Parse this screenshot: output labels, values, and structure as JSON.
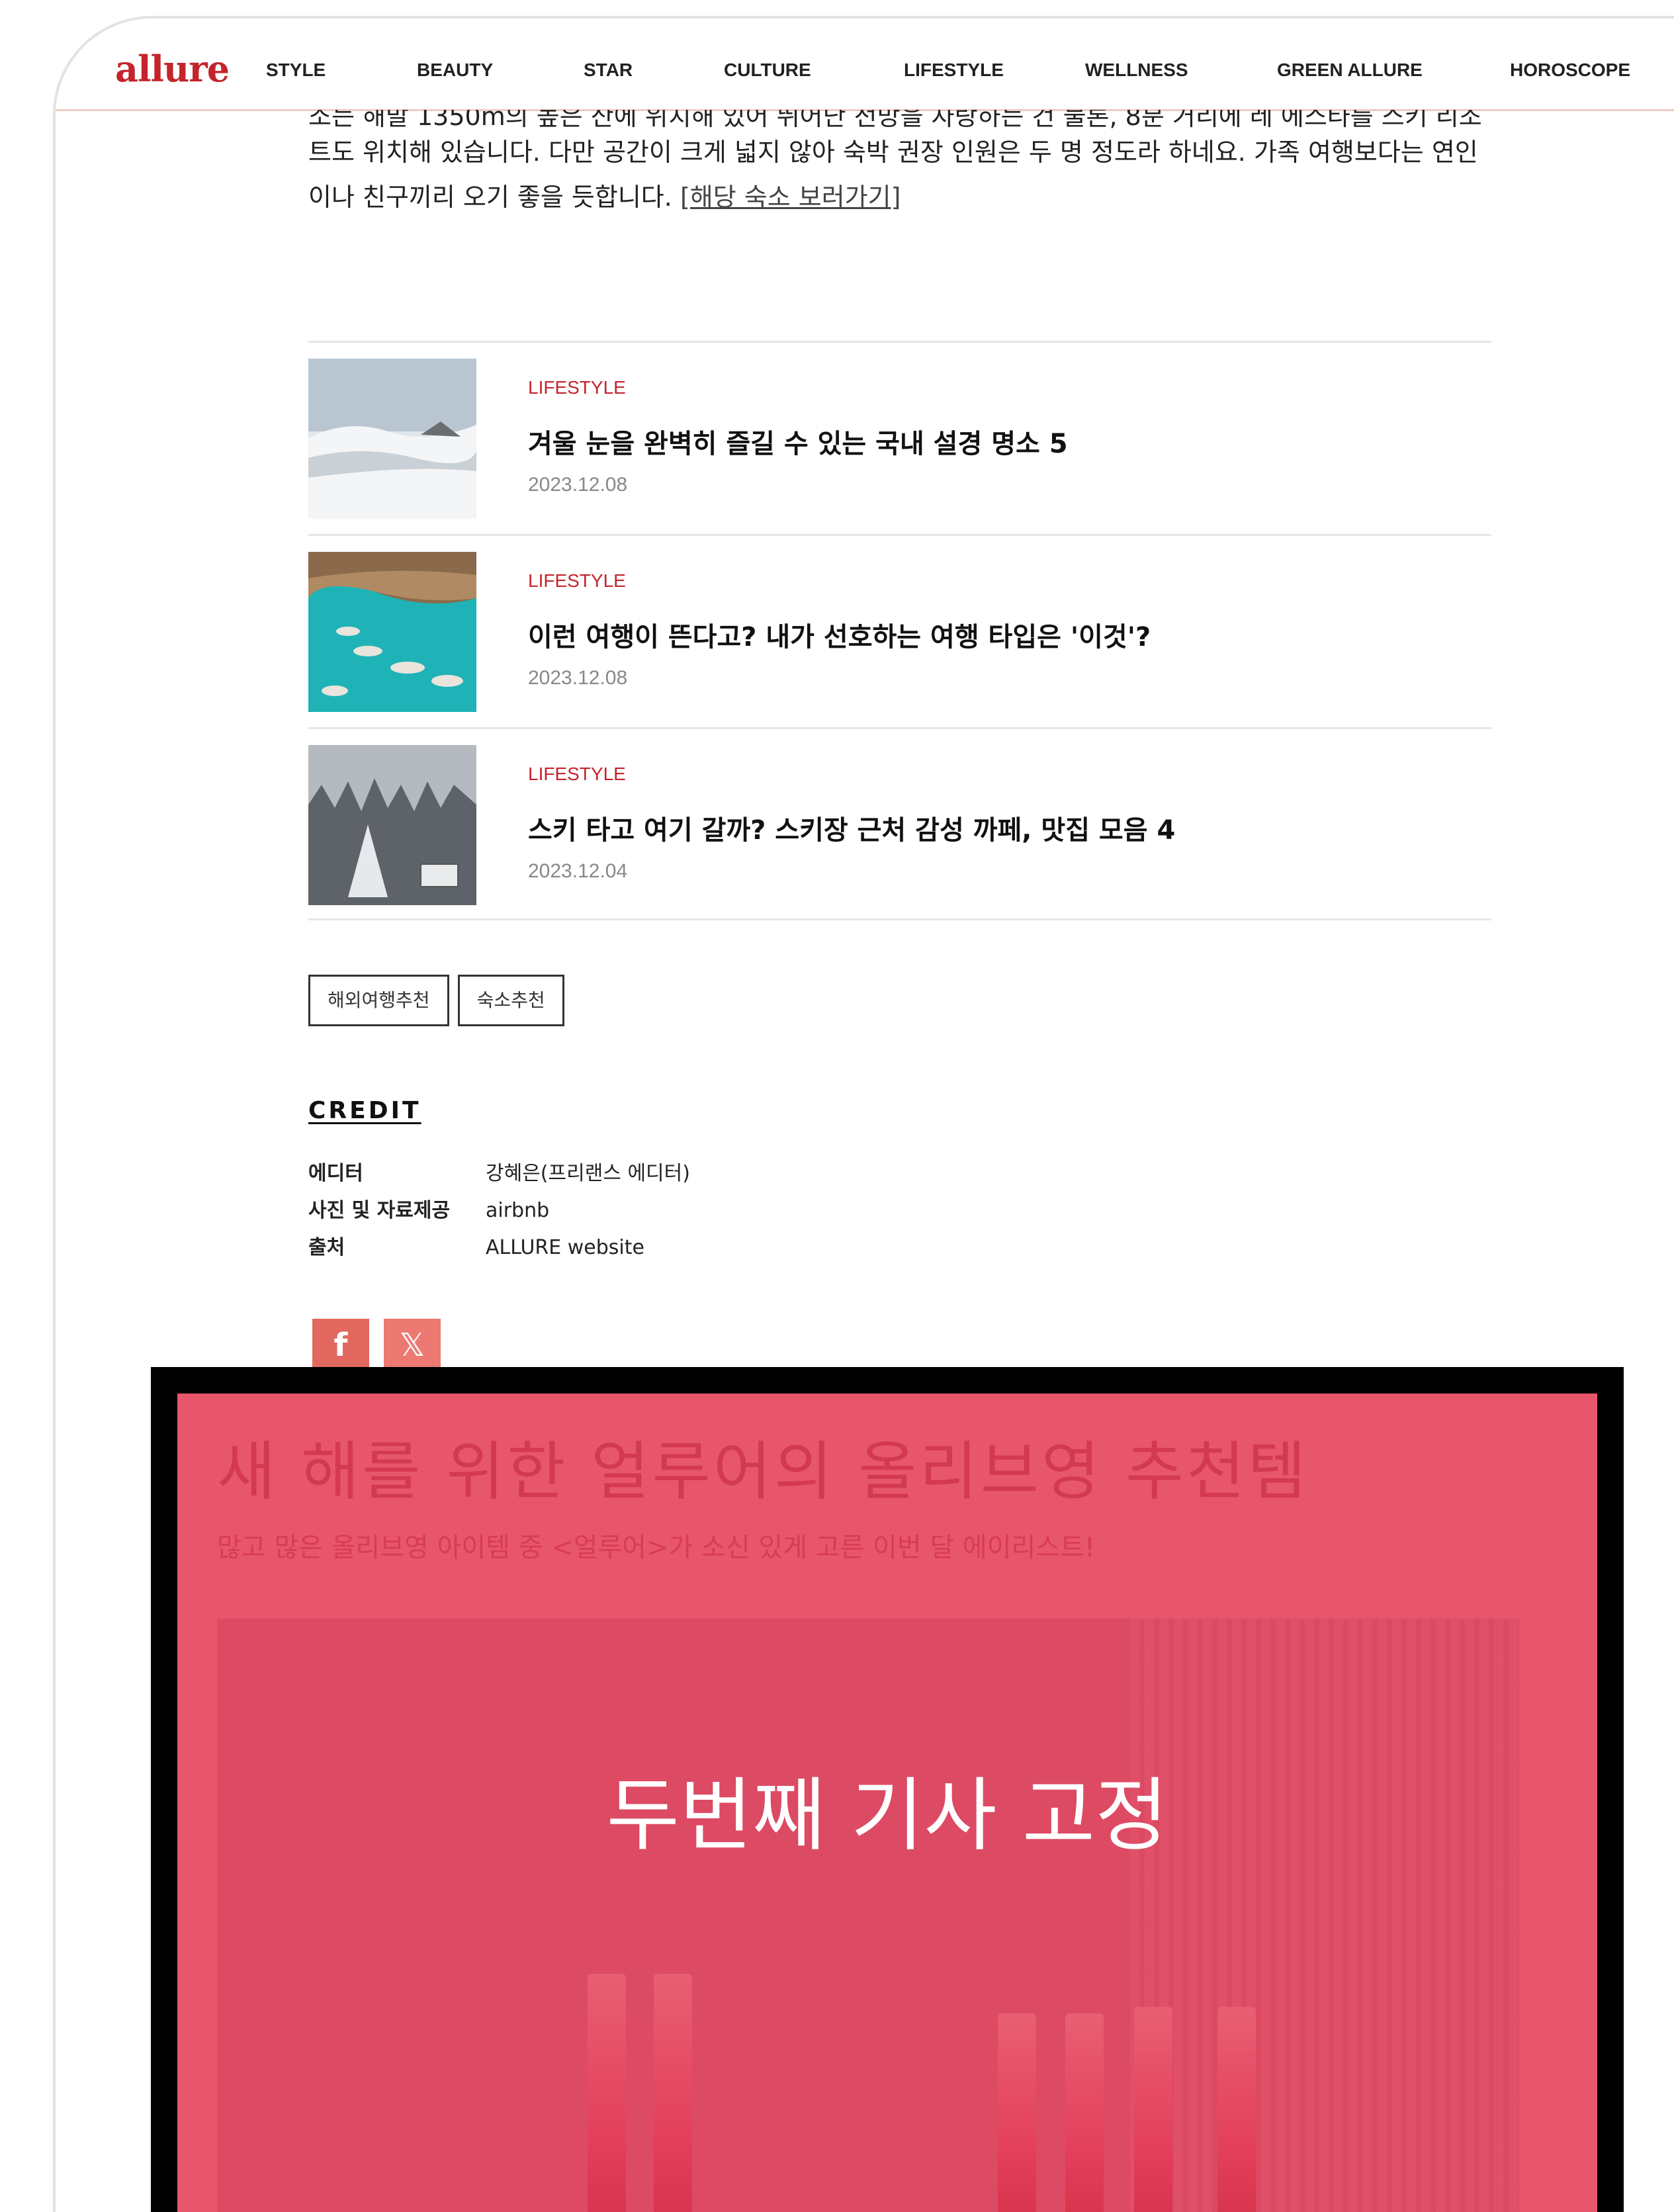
{
  "nav": {
    "logo": "allure",
    "items": [
      "STYLE",
      "BEAUTY",
      "STAR",
      "CULTURE",
      "LIFESTYLE",
      "WELLNESS",
      "GREEN ALLURE",
      "HOROSCOPE"
    ]
  },
  "article": {
    "line0": "소는 해발 1350m의 높은 산에 위치해 있어 뛰어난 전망을 자랑하는 건 물론, 8분 거리에 레 에스타를 스키 리조",
    "line1": "트도 위치해 있습니다. 다만 공간이 크게 넓지 않아 숙박 권장 인원은 두 명 정도라 하네요. 가족 여행보다는 연인",
    "line2": "이나 친구끼리 오기 좋을 듯합니다.",
    "link": "[해당 숙소 보러가기]"
  },
  "related": [
    {
      "category": "LIFESTYLE",
      "title": "겨울 눈을 완벽히 즐길 수 있는 국내 설경 명소 5",
      "date": "2023.12.08"
    },
    {
      "category": "LIFESTYLE",
      "title": "이런 여행이 뜬다고? 내가 선호하는 여행 타입은 '이것'?",
      "date": "2023.12.08"
    },
    {
      "category": "LIFESTYLE",
      "title": "스키 타고 여기 갈까? 스키장 근처 감성 까페, 맛집 모음 4",
      "date": "2023.12.04"
    }
  ],
  "tags": [
    "해외여행추천",
    "숙소추천"
  ],
  "credit": {
    "title": "CREDIT",
    "rows": [
      {
        "key": "에디터",
        "value": "강혜은(프리랜스 에디터)"
      },
      {
        "key": "사진 및 자료제공",
        "value": "airbnb"
      },
      {
        "key": "출처",
        "value": "ALLURE website"
      }
    ]
  },
  "share": {
    "facebook": "f",
    "x": "𝕏"
  },
  "overlay": {
    "title": "새 해를 위한 얼루어의 올리브영 추천템",
    "subtitle": "많고 많은 올리브영 아이템 중 <얼루어>가 소신 있게 고른 이번 달 에이리스트!",
    "center_label": "두번째 기사 고정"
  },
  "colors": {
    "brand": "#c4242b",
    "overlay_bg": "#e8566c",
    "share_bg": "#e2685f"
  }
}
